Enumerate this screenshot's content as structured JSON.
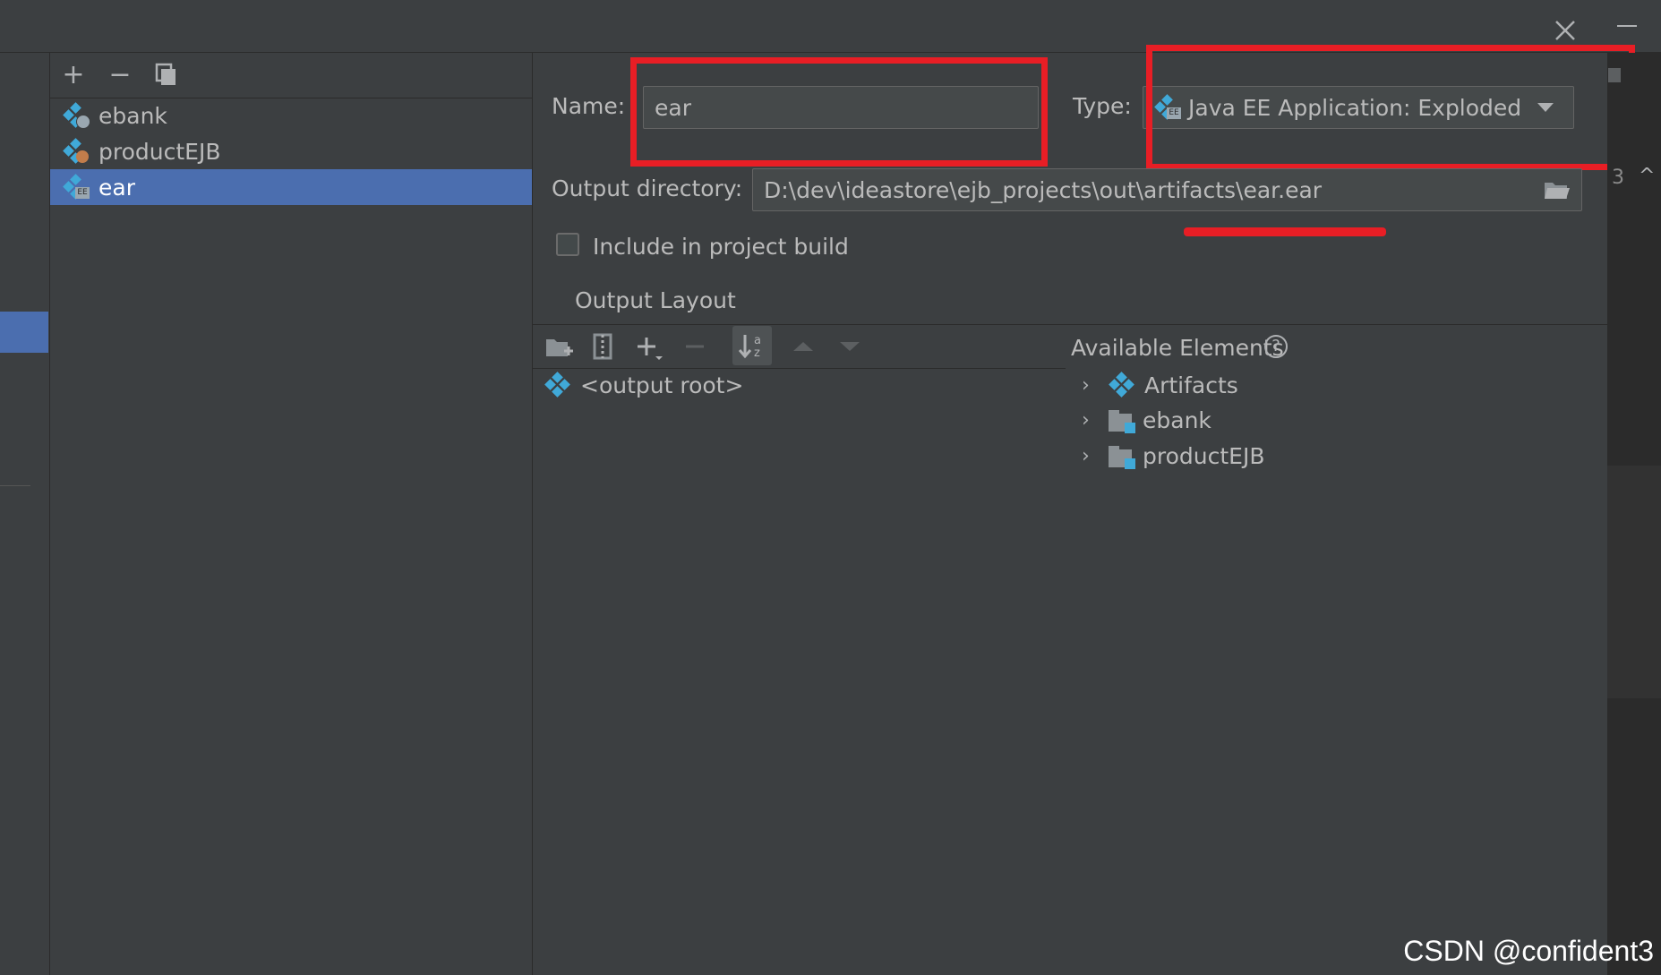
{
  "dialog": {
    "close_icon": "close-icon",
    "minimize_icon": "minimize-icon",
    "edge_number": "3",
    "edge_chevron": "^"
  },
  "artifact_list": {
    "toolbar": {
      "add": "+",
      "remove": "−",
      "copy_icon": "copy-icon"
    },
    "items": [
      {
        "label": "ebank",
        "icon": "war-exploded-icon",
        "selected": false
      },
      {
        "label": "productEJB",
        "icon": "ejb-icon",
        "selected": false
      },
      {
        "label": "ear",
        "icon": "ear-exploded-icon",
        "selected": true
      }
    ]
  },
  "form": {
    "name_label": "Name:",
    "name_value": "ear",
    "type_label": "Type:",
    "type_value": "Java EE Application: Exploded",
    "output_dir_label": "Output directory:",
    "output_dir_value": "D:\\dev\\ideastore\\ejb_projects\\out\\artifacts\\ear.ear",
    "include_label": "Include in project build",
    "include_checked": false,
    "output_layout_tab": "Output Layout"
  },
  "layout_toolbar": {
    "icons": [
      "create-directory-icon",
      "archive-icon",
      "add-icon",
      "remove-icon",
      "sort-icon",
      "move-up-icon",
      "move-down-icon"
    ]
  },
  "output_tree": {
    "root_label": "<output root>"
  },
  "available_elements": {
    "title": "Available Elements",
    "help": "?",
    "items": [
      {
        "label": "Artifacts",
        "icon": "artifacts-icon"
      },
      {
        "label": "ebank",
        "icon": "module-folder-icon"
      },
      {
        "label": "productEJB",
        "icon": "module-folder-icon"
      }
    ]
  },
  "annotation_colors": {
    "highlight": "#e81e25",
    "selection": "#4b6eaf",
    "accent": "#40a9d8"
  },
  "watermark": "CSDN @confident3"
}
